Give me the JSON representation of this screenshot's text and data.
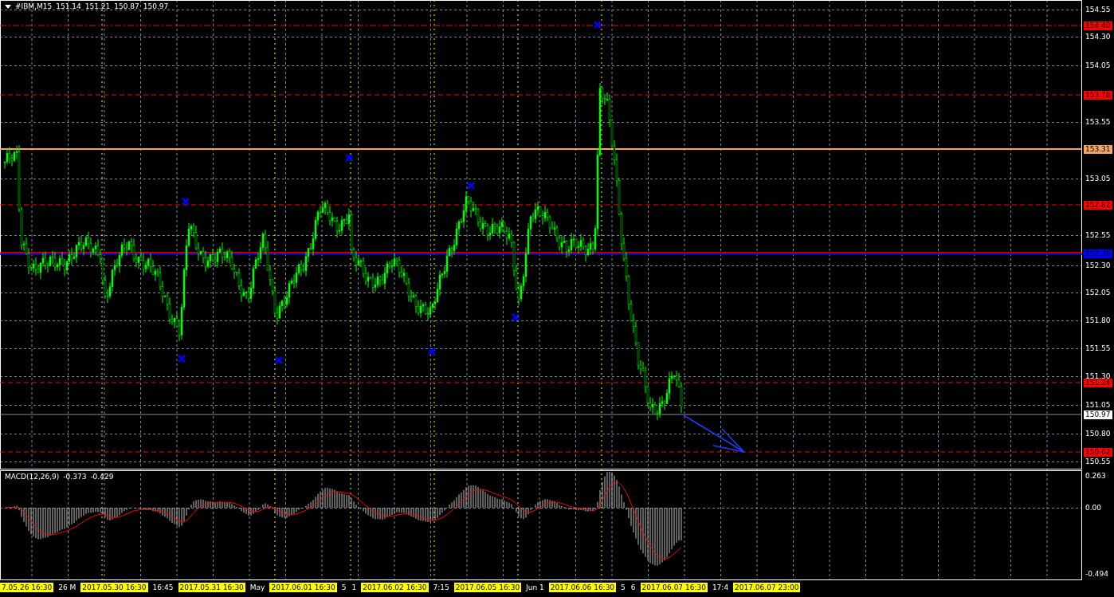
{
  "chart": {
    "symbol_title": "#IBM,M15",
    "ohlc": [
      "151.14",
      "151.21",
      "150.87",
      "150.97"
    ]
  },
  "price_axis": {
    "labels": [
      {
        "text": "154.55",
        "kind": "plain"
      },
      {
        "text": "154.40",
        "kind": "tag",
        "color": "#ff0000"
      },
      {
        "text": "154.30",
        "kind": "plain"
      },
      {
        "text": "154.05",
        "kind": "plain"
      },
      {
        "text": "153.78",
        "kind": "tag",
        "color": "#ff0000"
      },
      {
        "text": "153.55",
        "kind": "plain"
      },
      {
        "text": "153.31",
        "kind": "tag",
        "color": "#f4a460"
      },
      {
        "text": "153.05",
        "kind": "plain"
      },
      {
        "text": "152.82",
        "kind": "tag",
        "color": "#ff0000"
      },
      {
        "text": "152.55",
        "kind": "plain"
      },
      {
        "text": "152.38",
        "kind": "tag",
        "color": "#0000ff"
      },
      {
        "text": "152.30",
        "kind": "plain"
      },
      {
        "text": "152.05",
        "kind": "plain"
      },
      {
        "text": "151.80",
        "kind": "plain"
      },
      {
        "text": "151.55",
        "kind": "plain"
      },
      {
        "text": "151.30",
        "kind": "plain"
      },
      {
        "text": "151.24",
        "kind": "tag",
        "color": "#ff0000"
      },
      {
        "text": "151.05",
        "kind": "plain"
      },
      {
        "text": "150.97",
        "kind": "tag",
        "color": "#ffffff"
      },
      {
        "text": "150.80",
        "kind": "plain"
      },
      {
        "text": "150.62",
        "kind": "tag",
        "color": "#ff0000"
      },
      {
        "text": "150.55",
        "kind": "plain"
      }
    ]
  },
  "macd": {
    "title": "MACD(12,26,9)",
    "values": [
      "-0.373",
      "-0.429"
    ],
    "axis_labels": [
      "0.263",
      "0.00",
      "-0.494"
    ]
  },
  "time_axis": {
    "labels": [
      {
        "text": "7.05.26 16:30",
        "kind": "tag"
      },
      {
        "text": "26 M",
        "kind": "plain"
      },
      {
        "text": "2017.05.30 16:30",
        "kind": "tag"
      },
      {
        "text": "16:45",
        "kind": "plain"
      },
      {
        "text": "2017.05.31 16:30",
        "kind": "tag"
      },
      {
        "text": "May",
        "kind": "plain"
      },
      {
        "text": "2017.06.01 16:30",
        "kind": "tag"
      },
      {
        "text": "5",
        "kind": "plain"
      },
      {
        "text": "1",
        "kind": "plain"
      },
      {
        "text": "2017.06.02 16:30",
        "kind": "tag"
      },
      {
        "text": "7:15",
        "kind": "plain"
      },
      {
        "text": "2017.06.05 16:30",
        "kind": "tag"
      },
      {
        "text": "Jun 1",
        "kind": "plain"
      },
      {
        "text": "2017.06.06 16:30",
        "kind": "tag"
      },
      {
        "text": "5",
        "kind": "plain"
      },
      {
        "text": "6",
        "kind": "plain"
      },
      {
        "text": "2017.06.07 16:30",
        "kind": "tag"
      },
      {
        "text": "17:4",
        "kind": "plain"
      },
      {
        "text": "2017.06.07 23:00",
        "kind": "tag"
      }
    ]
  }
}
